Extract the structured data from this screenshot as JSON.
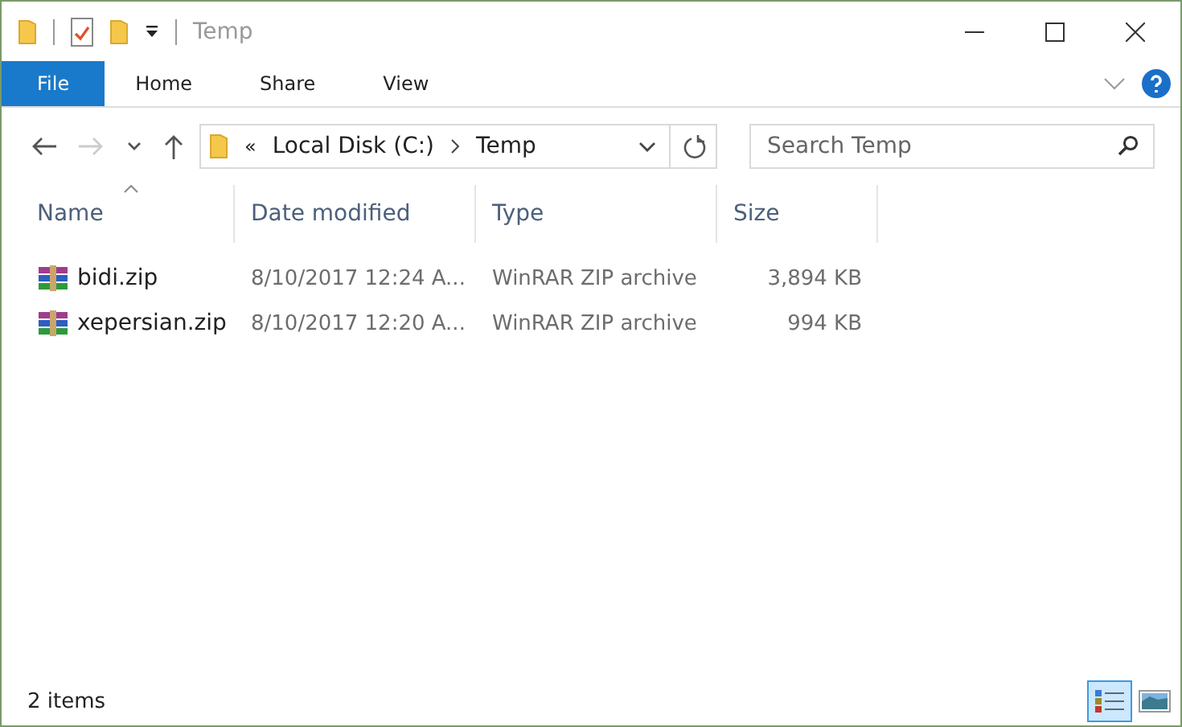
{
  "window": {
    "title": "Temp"
  },
  "ribbon_tabs": [
    {
      "label": "File",
      "kind": "file"
    },
    {
      "label": "Home",
      "kind": "tab"
    },
    {
      "label": "Share",
      "kind": "tab"
    },
    {
      "label": "View",
      "kind": "tab"
    }
  ],
  "address_bar": {
    "overflow": "«",
    "crumbs": [
      "Local Disk (C:)",
      "Temp"
    ]
  },
  "search": {
    "placeholder": "Search Temp"
  },
  "columns": [
    {
      "label": "Name",
      "sorted": true
    },
    {
      "label": "Date modified",
      "sorted": false
    },
    {
      "label": "Type",
      "sorted": false
    },
    {
      "label": "Size",
      "sorted": false
    }
  ],
  "rows": [
    {
      "name": "bidi.zip",
      "date": "8/10/2017 12:24 A...",
      "type": "WinRAR ZIP archive",
      "size": "3,894 KB"
    },
    {
      "name": "xepersian.zip",
      "date": "8/10/2017 12:20 A...",
      "type": "WinRAR ZIP archive",
      "size": "994 KB"
    }
  ],
  "status_bar": {
    "count": "2 items"
  },
  "view_buttons": [
    {
      "kind": "details",
      "selected": true
    },
    {
      "kind": "large-icons",
      "selected": false
    }
  ]
}
